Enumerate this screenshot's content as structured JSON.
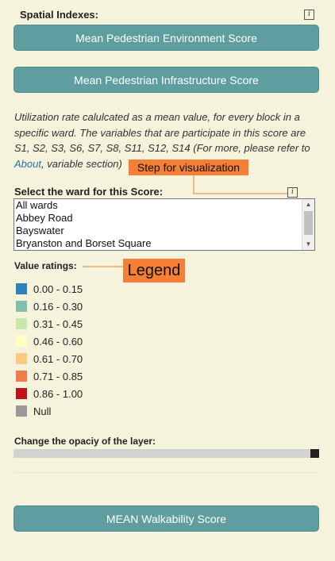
{
  "spatial": {
    "title": "Spatial Indexes:",
    "info": "i",
    "btn_env": "Mean Pedestrian Environment Score",
    "btn_infra": "Mean Pedestrian Infrastructure Score"
  },
  "description": {
    "text": "Utilization rate calulcated as a mean value, for every block in a specific ward. The variables that are participate in this score are S1, S2, S3, S6, S7, S8, S11, S12, S14 (For more, please refer to ",
    "link": "About",
    "tail": ", variable section)"
  },
  "callouts": {
    "step": "Step for visualization",
    "legend": "Legend",
    "color": "#f57f36"
  },
  "ward": {
    "label": "Select the ward for this Score:",
    "info": "i",
    "options": [
      "All wards",
      "Abbey Road",
      "Bayswater",
      "Bryanston and Borset Square"
    ]
  },
  "legend": {
    "title": "Value ratings:",
    "items": [
      {
        "label": "0.00 - 0.15",
        "color": "#2b83ba"
      },
      {
        "label": "0.16 - 0.30",
        "color": "#80bfab"
      },
      {
        "label": "0.31 - 0.45",
        "color": "#c7e8ad"
      },
      {
        "label": "0.46 - 0.60",
        "color": "#ffffbf"
      },
      {
        "label": "0.61 - 0.70",
        "color": "#fdc980"
      },
      {
        "label": "0.71 - 0.85",
        "color": "#f07c4a"
      },
      {
        "label": "0.86 - 1.00",
        "color": "#c0121b"
      },
      {
        "label": "Null",
        "color": "#999999"
      }
    ]
  },
  "opacity": {
    "label": "Change the opaciy of the layer:",
    "value_percent": 100
  },
  "footer": {
    "btn_mean": "MEAN Walkability Score"
  }
}
